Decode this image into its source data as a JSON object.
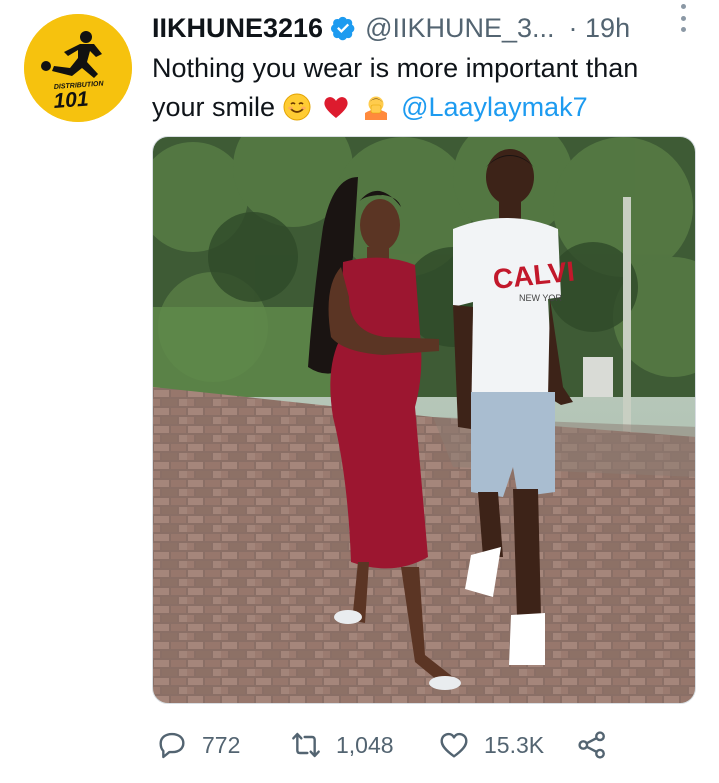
{
  "tweet": {
    "avatar": {
      "brand_text_top": "DISTRIBUTION",
      "brand_text_bottom": "101",
      "background": "#f6c20e"
    },
    "display_name": "IIKHUNE3216",
    "handle": "@IIKHUNE_3...",
    "time": "· 19h",
    "text_line_1": "Nothing you wear is more important than",
    "text_line_2_start": "your smile",
    "text_line_2_glyph": "",
    "mention": "@Laaylaymak7",
    "photo": {
      "shirt_text": "CALVI",
      "shirt_subtext": "NEW YOR"
    },
    "actions": {
      "replies": "772",
      "retweets": "1,048",
      "likes": "15.3K"
    }
  },
  "colors": {
    "accent": "#1d9bf0",
    "secondary_text": "#536471",
    "dress": "#9c1630",
    "brand_yellow": "#f6c20e"
  },
  "icons": [
    "verified-badge-icon",
    "more-icon",
    "smiling-face-icon",
    "red-heart-icon",
    "person-bowing-icon",
    "reply-icon",
    "retweet-icon",
    "like-icon",
    "share-icon"
  ]
}
